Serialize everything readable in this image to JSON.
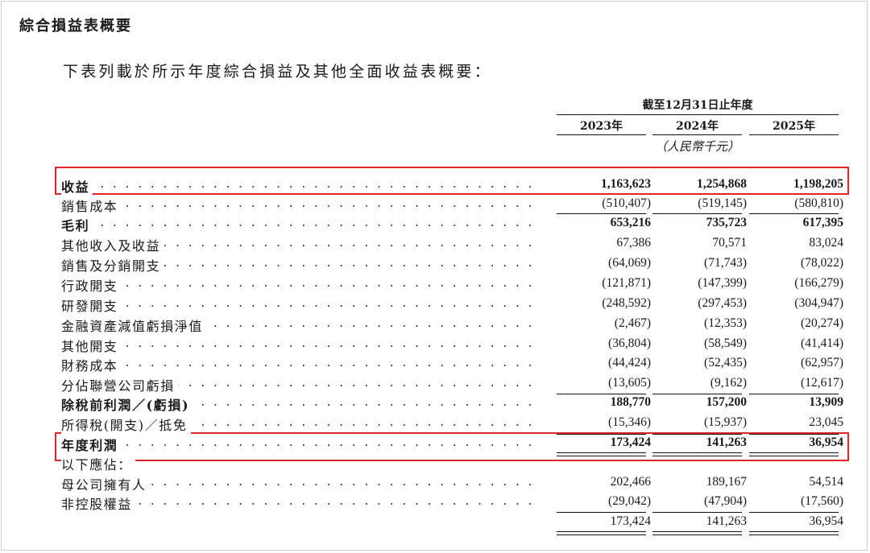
{
  "title": "綜合損益表概要",
  "intro": "下表列載於所示年度綜合損益及其他全面收益表概要：",
  "period_header": "截至12月31日止年度",
  "years": [
    "2023年",
    "2024年",
    "2025年"
  ],
  "unit": "（人民幣千元）",
  "rows": [
    {
      "label": "收益",
      "values": [
        "1,163,623",
        "1,254,868",
        "1,198,205"
      ]
    },
    {
      "label": "銷售成本",
      "values": [
        "(510,407)",
        "(519,145)",
        "(580,810)"
      ]
    },
    {
      "label": "毛利",
      "values": [
        "653,216",
        "735,723",
        "617,395"
      ]
    },
    {
      "label": "其他收入及收益",
      "values": [
        "67,386",
        "70,571",
        "83,024"
      ]
    },
    {
      "label": "銷售及分銷開支",
      "values": [
        "(64,069)",
        "(71,743)",
        "(78,022)"
      ]
    },
    {
      "label": "行政開支",
      "values": [
        "(121,871)",
        "(147,399)",
        "(166,279)"
      ]
    },
    {
      "label": "研發開支",
      "values": [
        "(248,592)",
        "(297,453)",
        "(304,947)"
      ]
    },
    {
      "label": "金融資產減值虧損淨值",
      "values": [
        "(2,467)",
        "(12,353)",
        "(20,274)"
      ]
    },
    {
      "label": "其他開支",
      "values": [
        "(36,804)",
        "(58,549)",
        "(41,414)"
      ]
    },
    {
      "label": "財務成本",
      "values": [
        "(44,424)",
        "(52,435)",
        "(62,957)"
      ]
    },
    {
      "label": "分佔聯營公司虧損",
      "values": [
        "(13,605)",
        "(9,162)",
        "(12,617)"
      ]
    },
    {
      "label": "除稅前利潤／(虧損)",
      "values": [
        "188,770",
        "157,200",
        "13,909"
      ]
    },
    {
      "label": "所得稅(開支)／抵免",
      "values": [
        "(15,346)",
        "(15,937)",
        "23,045"
      ]
    },
    {
      "label": "年度利潤",
      "values": [
        "173,424",
        "141,263",
        "36,954"
      ]
    },
    {
      "label": "以下應佔：",
      "values": [
        "",
        "",
        ""
      ]
    },
    {
      "label": "母公司擁有人",
      "values": [
        "202,466",
        "189,167",
        "54,514"
      ]
    },
    {
      "label": "非控股權益",
      "values": [
        "(29,042)",
        "(47,904)",
        "(17,560)"
      ]
    },
    {
      "label": "",
      "values": [
        "173,424",
        "141,263",
        "36,954"
      ]
    }
  ],
  "highlight_color": "#e0242a"
}
